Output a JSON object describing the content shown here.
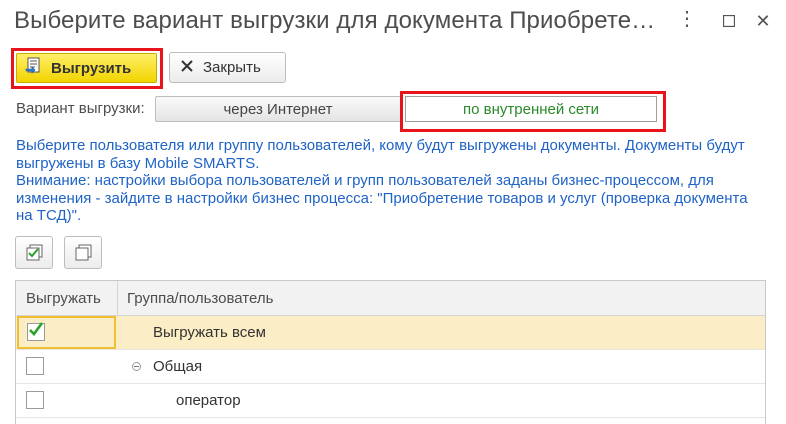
{
  "window": {
    "title": "Выберите вариант выгрузки для документа Приобрете…"
  },
  "toolbar": {
    "export_label": "Выгрузить",
    "close_label": "Закрыть"
  },
  "variant": {
    "label": "Вариант выгрузки:",
    "options": [
      {
        "label": "через Интернет",
        "selected": false
      },
      {
        "label": "по внутренней сети",
        "selected": true
      }
    ]
  },
  "info": {
    "line1": "Выберите пользователя или группу пользователей, кому будут выгружены документы. Документы будут выгружены в базу Mobile SMARTS.",
    "line2": "Внимание: настройки выбора пользователей и групп пользователей заданы бизнес-процессом, для изменения - зайдите в настройки бизнес процесса: \"Приобретение товаров и услуг (проверка документа на ТСД)\"."
  },
  "grid": {
    "columns": [
      "Выгружать",
      "Группа/пользователь"
    ],
    "rows": [
      {
        "checked": true,
        "name": "Выгружать всем",
        "level": 0,
        "group": false
      },
      {
        "checked": false,
        "name": "Общая",
        "level": 0,
        "group": true
      },
      {
        "checked": false,
        "name": "оператор",
        "level": 1,
        "group": false
      }
    ]
  },
  "colors": {
    "accent_yellow": "#f2d400",
    "highlight_red": "#e8141c",
    "info_blue": "#1f63c6",
    "selected_green": "#2a8a2a",
    "row_selected": "#fbeec6"
  }
}
